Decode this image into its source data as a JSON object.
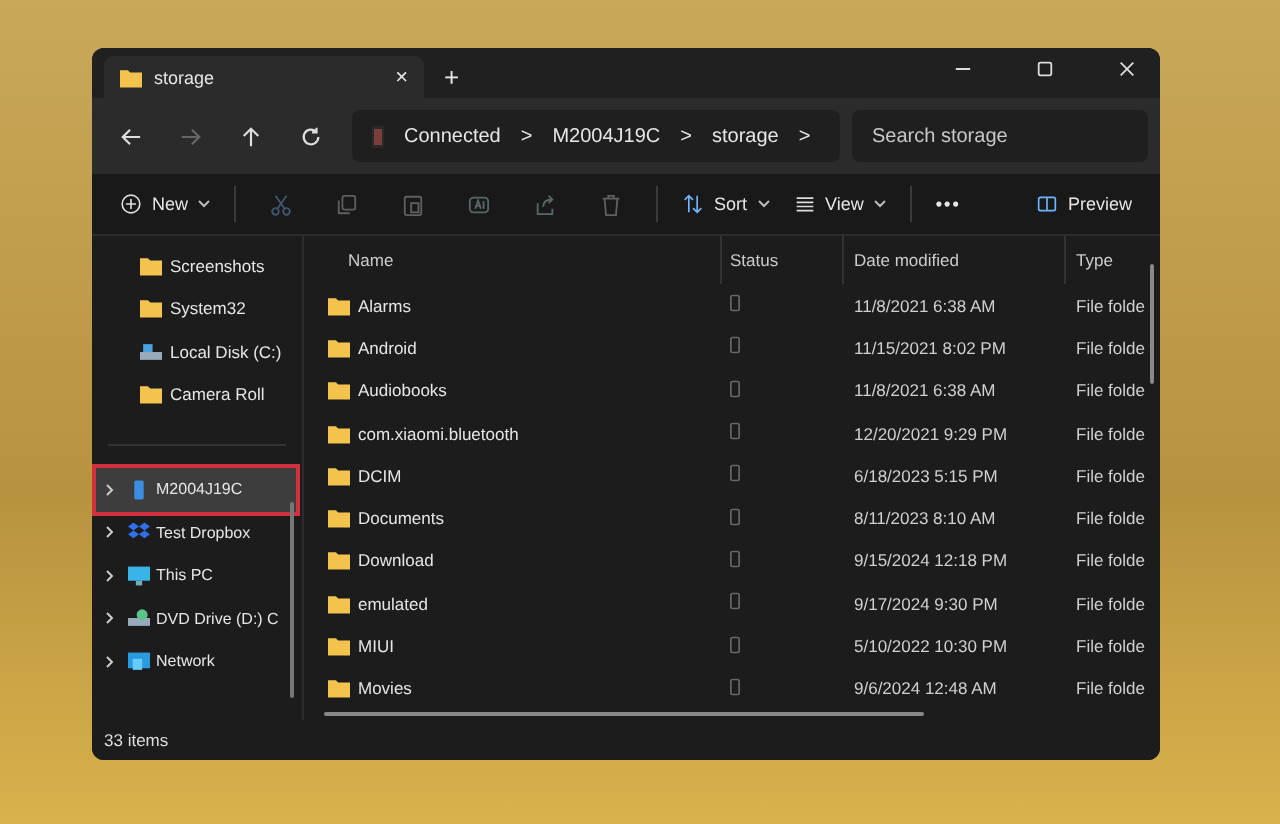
{
  "tab": {
    "title": "storage",
    "close": "×"
  },
  "new_tab": "+",
  "address": {
    "segments": [
      "Connected",
      "M2004J19C",
      "storage"
    ],
    "separator": ">"
  },
  "search": {
    "placeholder": "Search storage"
  },
  "toolbar": [
    {
      "kind": "new",
      "label": "New",
      "disabled": false
    },
    {
      "kind": "cut",
      "disabled": true
    },
    {
      "kind": "copy",
      "disabled": true
    },
    {
      "kind": "paste",
      "disabled": true
    },
    {
      "kind": "rename",
      "disabled": true
    },
    {
      "kind": "share",
      "disabled": true
    },
    {
      "kind": "delete",
      "disabled": true
    },
    {
      "kind": "sort",
      "label": "Sort",
      "disabled": false
    },
    {
      "kind": "view",
      "label": "View",
      "disabled": false
    },
    {
      "kind": "more",
      "label": "•••",
      "disabled": false
    }
  ],
  "preview": {
    "label": "Preview"
  },
  "sidebar": {
    "items": [
      {
        "label": "Screenshots",
        "kind": "folder",
        "expandable": false,
        "selected": false
      },
      {
        "label": "System32",
        "kind": "folder",
        "expandable": false,
        "selected": false
      },
      {
        "label": "Local Disk (C:)",
        "kind": "drive",
        "expandable": false,
        "selected": false
      },
      {
        "label": "Camera Roll",
        "kind": "folder",
        "expandable": false,
        "selected": false
      },
      {
        "label": "M2004J19C",
        "kind": "phone",
        "expandable": true,
        "selected": true
      },
      {
        "label": "Test Dropbox",
        "kind": "dropbox",
        "expandable": true,
        "selected": false
      },
      {
        "label": "This PC",
        "kind": "pc",
        "expandable": true,
        "selected": false
      },
      {
        "label": "DVD Drive (D:) C",
        "kind": "dvd",
        "expandable": true,
        "selected": false
      },
      {
        "label": "Network",
        "kind": "network",
        "expandable": true,
        "selected": false
      }
    ]
  },
  "table": {
    "columns": [
      "Name",
      "Status",
      "Date modified",
      "Type"
    ],
    "rows": [
      {
        "name": "Alarms",
        "date": "11/8/2021 6:38 AM",
        "type": "File folde"
      },
      {
        "name": "Android",
        "date": "11/15/2021 8:02 PM",
        "type": "File folde"
      },
      {
        "name": "Audiobooks",
        "date": "11/8/2021 6:38 AM",
        "type": "File folde"
      },
      {
        "name": "com.xiaomi.bluetooth",
        "date": "12/20/2021 9:29 PM",
        "type": "File folde"
      },
      {
        "name": "DCIM",
        "date": "6/18/2023 5:15 PM",
        "type": "File folde"
      },
      {
        "name": "Documents",
        "date": "8/11/2023 8:10 AM",
        "type": "File folde"
      },
      {
        "name": "Download",
        "date": "9/15/2024 12:18 PM",
        "type": "File folde"
      },
      {
        "name": "emulated",
        "date": "9/17/2024 9:30 PM",
        "type": "File folde"
      },
      {
        "name": "MIUI",
        "date": "5/10/2022 10:30 PM",
        "type": "File folde"
      },
      {
        "name": "Movies",
        "date": "9/6/2024 12:48 AM",
        "type": "File folde"
      }
    ]
  },
  "status_bar": {
    "count": "33 items"
  }
}
